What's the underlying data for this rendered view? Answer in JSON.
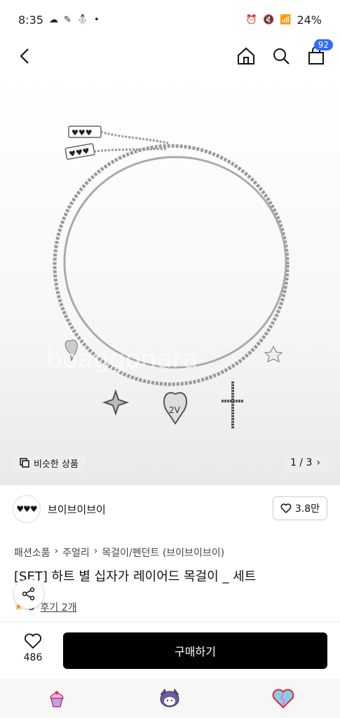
{
  "status": {
    "time": "8:35",
    "battery": "24%"
  },
  "topbar": {
    "cart_count": "92"
  },
  "hero": {
    "watermark": "boaggonara",
    "similar_label": "비슷한 상품",
    "pager": "1 / 3"
  },
  "brand": {
    "logo_text": "♥♥♥",
    "name": "브이브이브이",
    "likes": "3.8만"
  },
  "breadcrumbs": [
    "패션소품",
    "주얼리",
    "목걸이/펜던트 (브이브이브이)"
  ],
  "product": {
    "title": "[SET] 하트 별 십자가 레이어드 목걸이 _ 세트",
    "rating": "5",
    "review": "후기 2개"
  },
  "buybar": {
    "likes": "486",
    "buy_label": "구매하기"
  },
  "colors": {
    "accent": "#2f6bff",
    "buy": "#000000"
  }
}
